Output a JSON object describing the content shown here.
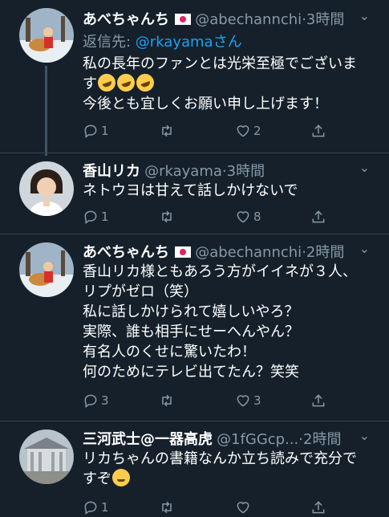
{
  "tweets": [
    {
      "name": "あべちゃんち",
      "handle": "@abechannchi",
      "time": "·3時間",
      "reply_prefix": "返信先: ",
      "reply_mention": "@rkayama",
      "reply_suffix": "さん",
      "lines": [
        "私の長年のファンとは光栄至極でございま",
        "す",
        "今後とも宜しくお願い申し上げます！"
      ],
      "counts": {
        "reply": "1",
        "retweet": "",
        "like": "2"
      }
    },
    {
      "name": "香山リカ",
      "handle": "@rkayama",
      "time": "·3時間",
      "lines": [
        "ネトウヨは甘えて話しかけないで"
      ],
      "counts": {
        "reply": "1",
        "retweet": "",
        "like": "8"
      }
    },
    {
      "name": "あべちゃんち",
      "handle": "@abechannchi",
      "time": "·2時間",
      "lines": [
        "香山リカ様ともあろう方がイイネが３人、",
        "リプがゼロ（笑）",
        "私に話しかけられて嬉しいやろ？",
        "実際、誰も相手にせーへんやん？",
        "有名人のくせに驚いたわ！",
        "何のためにテレビ出てたん？笑笑"
      ],
      "counts": {
        "reply": "3",
        "retweet": "",
        "like": "3"
      }
    },
    {
      "name": "三河武士@一器高虎",
      "handle": "@1fGGcp...",
      "time": "·2時間",
      "lines": [
        "リカちゃんの書籍なんか立ち読みで充分で",
        "すぞ"
      ],
      "counts": {
        "reply": "1",
        "retweet": "",
        "like": ""
      }
    }
  ],
  "icons": {
    "reply": "reply-bubble-icon",
    "retweet": "retweet-icon",
    "like": "heart-icon",
    "share": "share-icon",
    "caret": "chevron-down-icon"
  },
  "colors": {
    "background": "#15202b",
    "secondary_text": "#8899a6",
    "link": "#1da1f2",
    "divider": "#38444d"
  }
}
